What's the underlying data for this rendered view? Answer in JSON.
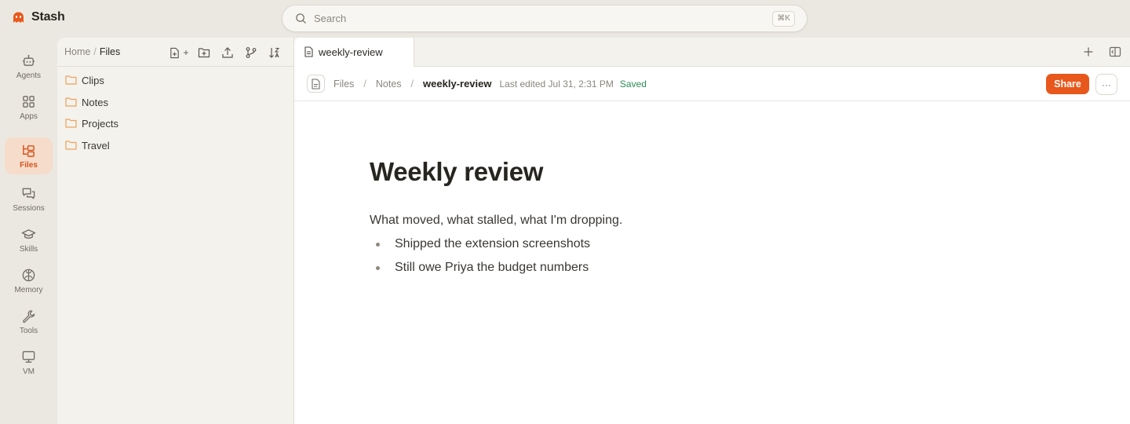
{
  "app": {
    "name": "Stash"
  },
  "search": {
    "placeholder": "Search",
    "shortcut": "⌘K"
  },
  "rail": {
    "items": [
      {
        "label": "Agents",
        "icon": "robot-icon",
        "active": false
      },
      {
        "label": "Apps",
        "icon": "grid-icon",
        "active": false
      },
      {
        "label": "Files",
        "icon": "files-icon",
        "active": true
      },
      {
        "label": "Sessions",
        "icon": "chat-bubbles-icon",
        "active": false
      },
      {
        "label": "Skills",
        "icon": "graduation-cap-icon",
        "active": false
      },
      {
        "label": "Memory",
        "icon": "brain-icon",
        "active": false
      },
      {
        "label": "Tools",
        "icon": "wrench-icon",
        "active": false
      },
      {
        "label": "VM",
        "icon": "monitor-icon",
        "active": false
      }
    ]
  },
  "files_panel": {
    "breadcrumb": {
      "home": "Home",
      "separator": "/",
      "current": "Files"
    },
    "toolbar_icons": [
      "new-file-icon",
      "new-folder-icon",
      "upload-icon",
      "git-branch-icon",
      "sort-icon"
    ],
    "new_file_suffix": "+",
    "folders": [
      "Clips",
      "Notes",
      "Projects",
      "Travel"
    ]
  },
  "tabs": [
    {
      "label": "weekly-review",
      "active": true
    }
  ],
  "doc_header": {
    "crumbs": [
      "Files",
      "Notes"
    ],
    "separator": "/",
    "title": "weekly-review",
    "last_edited": "Last edited Jul 31, 2:31 PM",
    "status": "Saved",
    "share_label": "Share",
    "more_label": "···"
  },
  "document": {
    "title": "Weekly review",
    "intro": "What moved, what stalled, what I'm dropping.",
    "bullets": [
      "Shipped the extension screenshots",
      "Still owe Priya the budget numbers"
    ]
  },
  "colors": {
    "accent": "#e8581c",
    "active_rail_bg": "#f6dccb",
    "saved_green": "#2e8b57",
    "app_background": "#ebe8e1",
    "folder_orange": "#eba35e"
  }
}
